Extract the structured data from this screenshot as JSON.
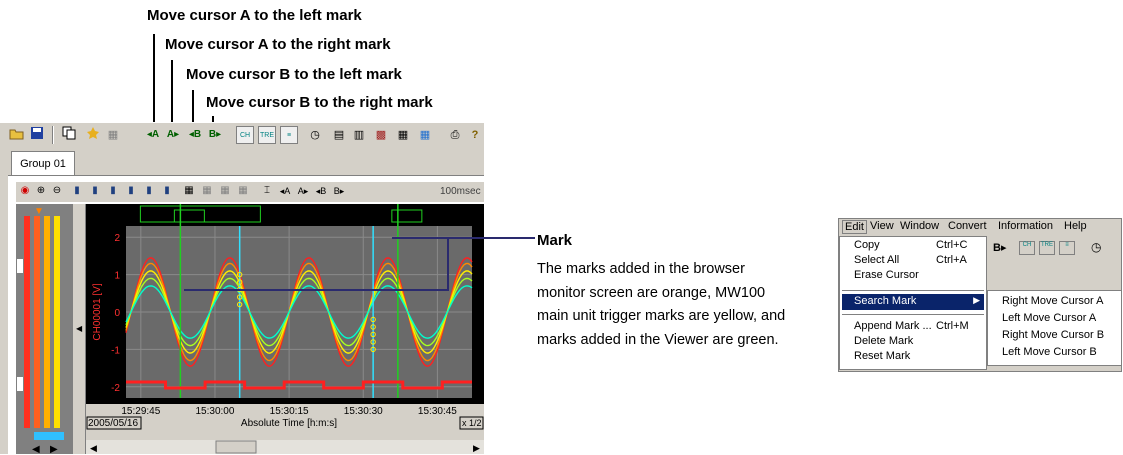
{
  "callouts": [
    "Move cursor A to the left mark",
    "Move cursor A to the right mark",
    "Move cursor B to the left mark",
    "Move cursor B to the right mark"
  ],
  "tab": {
    "label": "Group 01"
  },
  "sample_rate": "100msec",
  "chart": {
    "ylabel": "CH00001 [V]",
    "y_ticks": [
      "2",
      "1",
      "0",
      "-1",
      "-2"
    ],
    "x_ticks": [
      "15:29:45",
      "15:30:00",
      "15:30:15",
      "15:30:30",
      "15:30:45"
    ],
    "date": "2005/05/16",
    "xlabel": "Absolute Time [h:m:s]",
    "zoom": "x 1/2",
    "toolbar_cursor_labels": [
      "A",
      "A",
      "B",
      "B"
    ]
  },
  "chart_data": {
    "type": "line",
    "ylim": [
      -2.3,
      2.3
    ],
    "xlim": [
      "15:29:42",
      "15:30:52"
    ],
    "x_ticks": [
      "15:29:45",
      "15:30:00",
      "15:30:15",
      "15:30:30",
      "15:30:45"
    ],
    "y_ticks": [
      2,
      1,
      0,
      -1,
      -2
    ],
    "series_colors": [
      "#ff2020",
      "#ff8800",
      "#ffee00",
      "#a8ff20",
      "#00ffcc"
    ],
    "amplitudes": [
      1.45,
      1.3,
      1.1,
      0.9,
      0.7
    ],
    "period_seconds": 16,
    "mark_lines": {
      "green": [
        "15:29:53",
        "15:30:37"
      ],
      "cyan": [
        "15:30:05",
        "15:30:32"
      ]
    }
  },
  "mark_panel": {
    "title": "Mark",
    "description": "The marks added in the browser monitor screen are orange, MW100 main unit trigger marks are yellow, and marks added in the Viewer are green."
  },
  "menu": {
    "bar": [
      "Edit",
      "View",
      "Window",
      "Convert",
      "Information",
      "Help"
    ],
    "items": [
      {
        "label": "Copy",
        "shortcut": "Ctrl+C"
      },
      {
        "label": "Select All",
        "shortcut": "Ctrl+A"
      },
      {
        "label": "Erase Cursor",
        "shortcut": ""
      },
      {
        "label": "Search Mark",
        "shortcut": ""
      },
      {
        "label": "Append Mark ...",
        "shortcut": "Ctrl+M"
      },
      {
        "label": "Delete Mark",
        "shortcut": ""
      },
      {
        "label": "Reset Mark",
        "shortcut": ""
      }
    ],
    "submenu": [
      "Right Move Cursor A",
      "Left Move Cursor A",
      "Right Move Cursor B",
      "Left Move Cursor B"
    ]
  },
  "colors": {
    "toolbar_bg": "#d4d0c8",
    "menu_highlight": "#0a246a",
    "mark_line": "#2a2a6e"
  }
}
